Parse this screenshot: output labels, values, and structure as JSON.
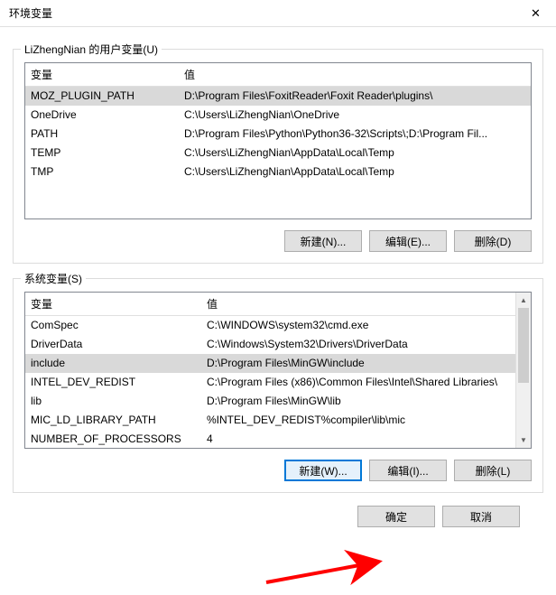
{
  "window": {
    "title": "环境变量"
  },
  "userGroup": {
    "legend": "LiZhengNian 的用户变量(U)",
    "cols": {
      "name": "变量",
      "value": "值"
    },
    "rows": [
      {
        "name": "MOZ_PLUGIN_PATH",
        "value": "D:\\Program Files\\FoxitReader\\Foxit Reader\\plugins\\",
        "sel": true
      },
      {
        "name": "OneDrive",
        "value": "C:\\Users\\LiZhengNian\\OneDrive",
        "sel": false
      },
      {
        "name": "PATH",
        "value": "D:\\Program Files\\Python\\Python36-32\\Scripts\\;D:\\Program Fil...",
        "sel": false
      },
      {
        "name": "TEMP",
        "value": "C:\\Users\\LiZhengNian\\AppData\\Local\\Temp",
        "sel": false
      },
      {
        "name": "TMP",
        "value": "C:\\Users\\LiZhengNian\\AppData\\Local\\Temp",
        "sel": false
      }
    ],
    "buttons": {
      "new": "新建(N)...",
      "edit": "编辑(E)...",
      "delete": "删除(D)"
    }
  },
  "sysGroup": {
    "legend": "系统变量(S)",
    "cols": {
      "name": "变量",
      "value": "值"
    },
    "rows": [
      {
        "name": "ComSpec",
        "value": "C:\\WINDOWS\\system32\\cmd.exe",
        "sel": false
      },
      {
        "name": "DriverData",
        "value": "C:\\Windows\\System32\\Drivers\\DriverData",
        "sel": false
      },
      {
        "name": "include",
        "value": "D:\\Program Files\\MinGW\\include",
        "sel": true
      },
      {
        "name": "INTEL_DEV_REDIST",
        "value": "C:\\Program Files (x86)\\Common Files\\Intel\\Shared Libraries\\",
        "sel": false
      },
      {
        "name": "lib",
        "value": "D:\\Program Files\\MinGW\\lib",
        "sel": false
      },
      {
        "name": "MIC_LD_LIBRARY_PATH",
        "value": "%INTEL_DEV_REDIST%compiler\\lib\\mic",
        "sel": false
      },
      {
        "name": "NUMBER_OF_PROCESSORS",
        "value": "4",
        "sel": false
      }
    ],
    "buttons": {
      "new": "新建(W)...",
      "edit": "编辑(I)...",
      "delete": "删除(L)"
    }
  },
  "footer": {
    "ok": "确定",
    "cancel": "取消"
  }
}
